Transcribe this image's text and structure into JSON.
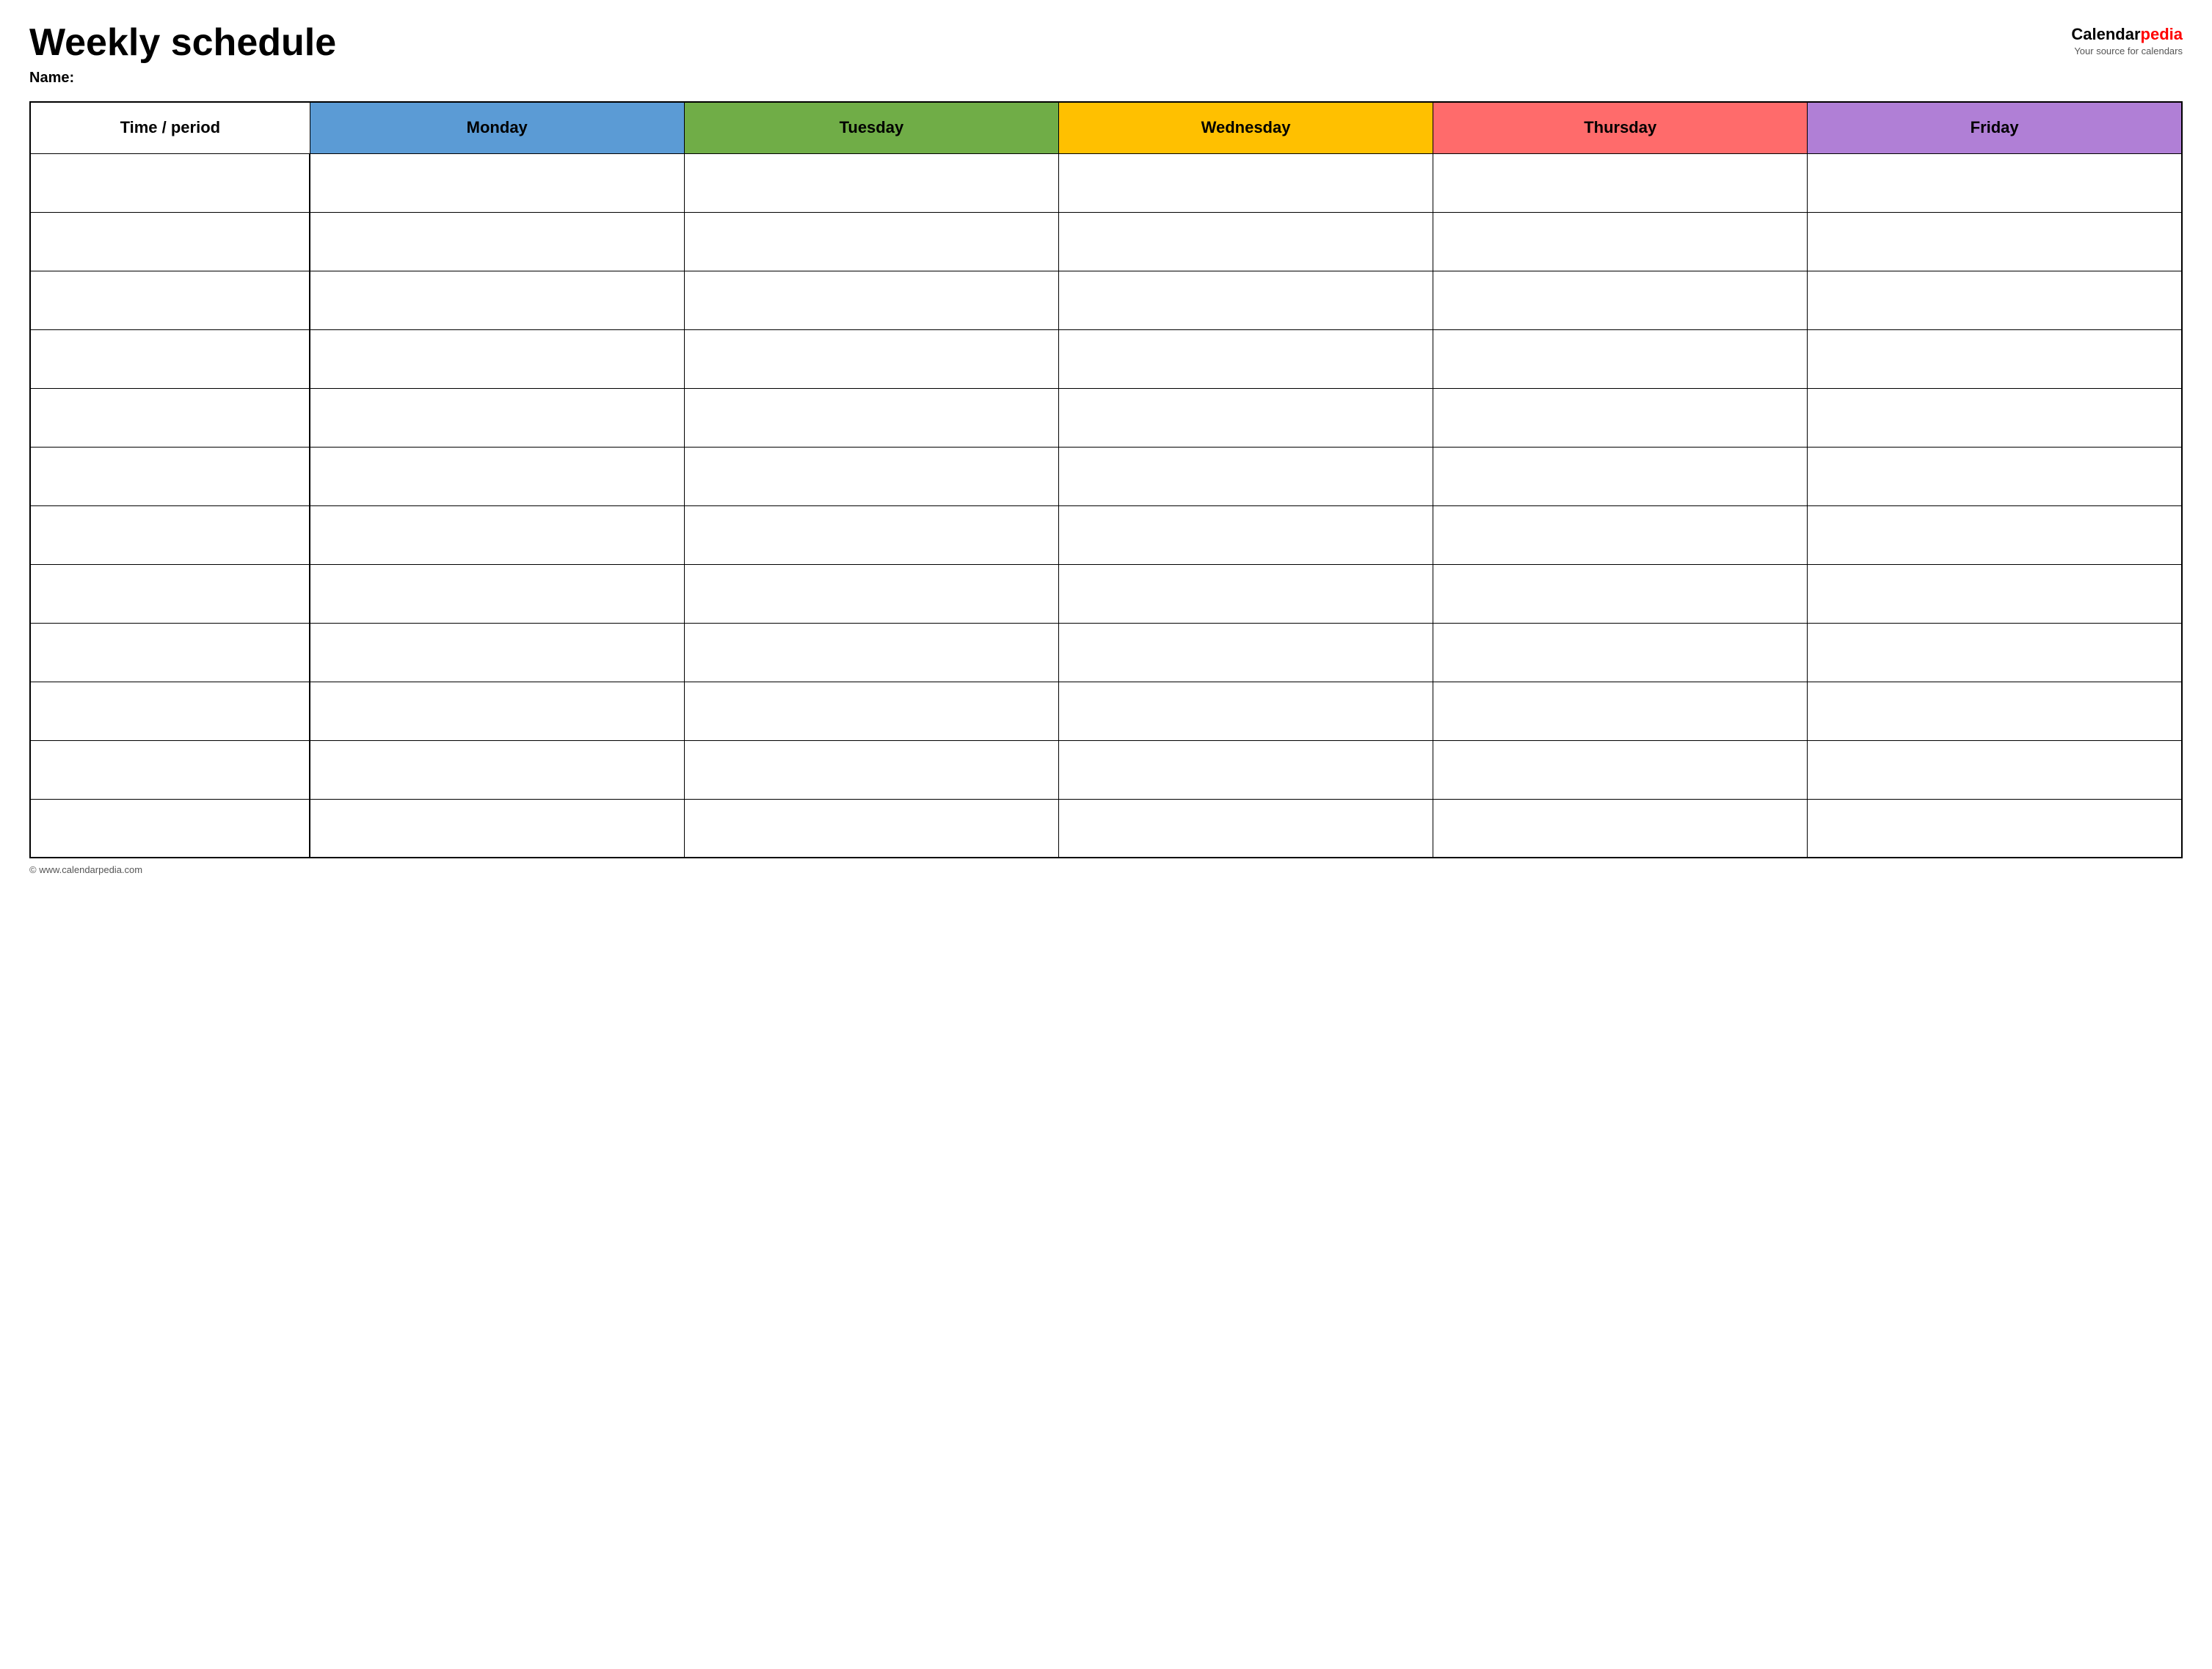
{
  "header": {
    "title": "Weekly schedule",
    "name_label": "Name:",
    "logo_calendar": "Calendar",
    "logo_pedia": "pedia",
    "logo_tagline": "Your source for calendars"
  },
  "table": {
    "headers": [
      {
        "id": "time",
        "label": "Time / period",
        "color": "#ffffff"
      },
      {
        "id": "monday",
        "label": "Monday",
        "color": "#5b9bd5"
      },
      {
        "id": "tuesday",
        "label": "Tuesday",
        "color": "#70ad47"
      },
      {
        "id": "wednesday",
        "label": "Wednesday",
        "color": "#ffc000"
      },
      {
        "id": "thursday",
        "label": "Thursday",
        "color": "#ff6b6b"
      },
      {
        "id": "friday",
        "label": "Friday",
        "color": "#b07fd6"
      }
    ],
    "row_count": 12
  },
  "footer": {
    "copyright": "© www.calendarpedia.com"
  }
}
